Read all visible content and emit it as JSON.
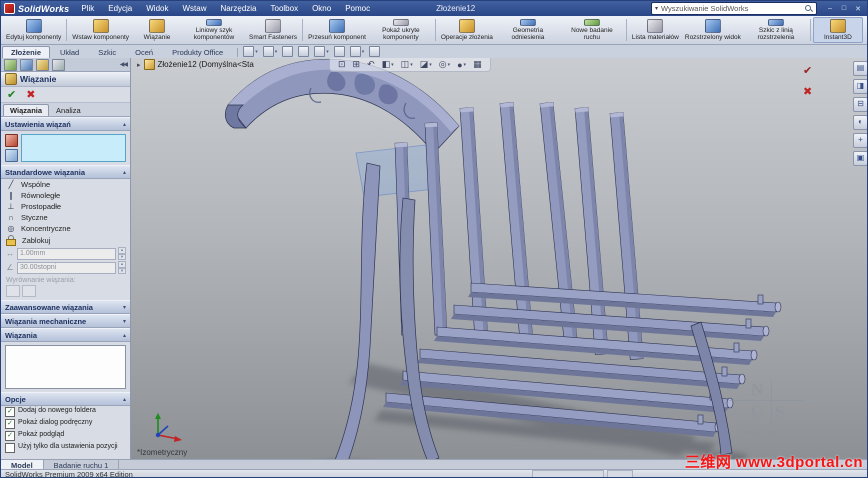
{
  "titlebar": {
    "logo": "SolidWorks",
    "doc": "Złożenie12",
    "search_placeholder": "Wyszukiwanie SolidWorks",
    "win": {
      "min": "–",
      "max": "□",
      "close": "✕"
    }
  },
  "menubar": {
    "items": [
      "Plik",
      "Edycja",
      "Widok",
      "Wstaw",
      "Narzędzia",
      "Toolbox",
      "Okno",
      "Pomoc"
    ]
  },
  "toolbar": {
    "buttons": [
      "Edytuj komponenty",
      "Wstaw komponenty",
      "Wiązanie",
      "Liniowy szyk komponentów",
      "Smart Fasteners",
      "Przesuń komponent",
      "Pokaż ukryte komponenty",
      "Operacje złożenia",
      "Geometria odniesienia",
      "Nowe badanie ruchu",
      "Lista materiałów",
      "Rozstrzelony widok",
      "Szkic z linią rozstrzelenia",
      "Instant3D"
    ]
  },
  "ribbon": {
    "tabs": [
      "Złożenie",
      "Układ",
      "Szkic",
      "Oceń",
      "Produkty Office"
    ]
  },
  "featuretree": {
    "root": "Złożenie12 (Domyślna<Sta"
  },
  "pm": {
    "title": "Wiązanie",
    "ok_icon": "✔",
    "cancel_icon": "✖",
    "tabs": [
      "Wiązania",
      "Analiza"
    ],
    "sections": {
      "settings": "Ustawienia wiązań",
      "standard": "Standardowe wiązania",
      "advanced": "Zaawansowane wiązania",
      "mechanical": "Wiązania mechaniczne",
      "mates": "Wiązania",
      "options": "Opcje"
    },
    "standard_mates": [
      {
        "label": "Wspólne",
        "glyph": "╱"
      },
      {
        "label": "Równoległe",
        "glyph": "∥"
      },
      {
        "label": "Prostopadłe",
        "glyph": "⊥"
      },
      {
        "label": "Styczne",
        "glyph": "∩"
      },
      {
        "label": "Koncentryczne",
        "glyph": "◎"
      },
      {
        "label": "Zablokuj",
        "glyph": ""
      }
    ],
    "distance": {
      "glyph": "↔",
      "value": "1.00mm"
    },
    "angle": {
      "glyph": "∠",
      "value": "30.00stopni"
    },
    "alignment_label": "Wyrównanie wiązania:",
    "options": [
      {
        "label": "Dodaj do nowego foldera",
        "checked": "✓"
      },
      {
        "label": "Pokaż dialog podręczny",
        "checked": "✓"
      },
      {
        "label": "Pokaż podgląd",
        "checked": "✓"
      },
      {
        "label": "Użyj tylko dla ustawienia pozycji",
        "checked": ""
      }
    ]
  },
  "viewport": {
    "view_label": "*Izometryczny",
    "confirm": {
      "ok": "✔",
      "cancel": "✖"
    },
    "headsup_icons": [
      "⊡",
      "⊞",
      "↶",
      "◧",
      "◫",
      "◪",
      "◎",
      "●",
      "▦"
    ],
    "right_icons": [
      "▤",
      "◨",
      "⊟",
      "◐",
      "+",
      "▣"
    ]
  },
  "icons": {
    "dropdown": "▾",
    "spinner_up": "▴",
    "spinner_dn": "▾",
    "collapse": "▴",
    "expand": "▾",
    "panel_collapse": "◀◀",
    "tree_expand": "▸"
  },
  "ncs": {
    "n": "N",
    "c": "C",
    "s": "S",
    "sub": "solutions",
    "tm": "™"
  },
  "docktabs": {
    "items": [
      "Model",
      "Badanie ruchu 1"
    ]
  },
  "statusbar": {
    "edition": "SolidWorks Premium 2009 x64 Edition"
  },
  "watermark": {
    "text": "三维网 www.3dportal.cn"
  }
}
